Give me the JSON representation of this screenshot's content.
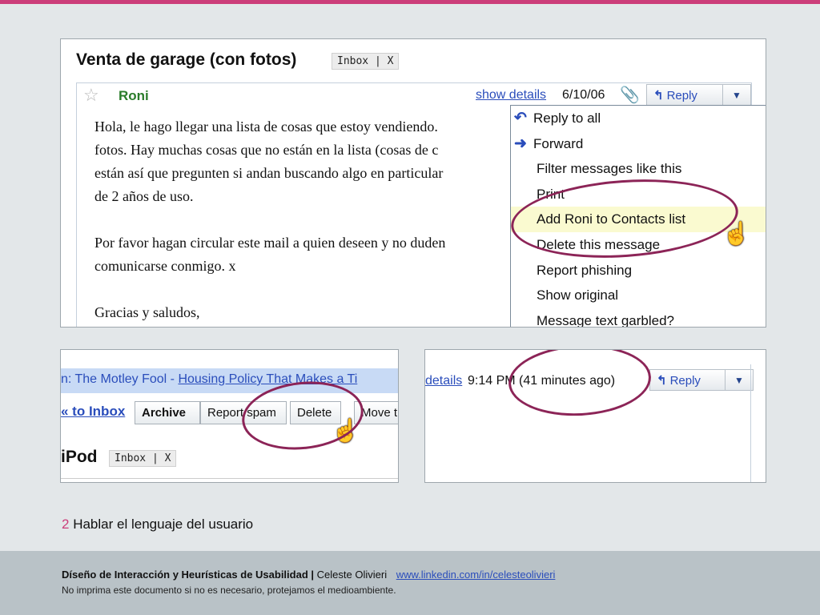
{
  "colors": {
    "accent": "#cc3e7a",
    "annotation_circle": "#8c2457",
    "link": "#2a4dbb",
    "sender": "#2a7c2a"
  },
  "main_shot": {
    "subject": "Venta de garage (con fotos)",
    "label": "Inbox | X",
    "sender": "Roni",
    "show_details": "show details",
    "date": "6/10/06",
    "reply_button": "Reply",
    "body_lines": [
      "Hola, le hago llegar una lista de cosas que estoy vendiendo.",
      "fotos. Hay muchas cosas que no están en la lista (cosas de c",
      "están así que pregunten si andan buscando algo en particular",
      "de 2 años de uso.",
      "",
      "Por favor hagan circular este mail a quien deseen y no duden",
      "comunicarse conmigo. x",
      "",
      "Gracias y saludos,"
    ],
    "menu_items": [
      {
        "label": "Reply to all",
        "icon": "reply-all-icon"
      },
      {
        "label": "Forward",
        "icon": "forward-icon"
      },
      {
        "label": "Filter messages like this"
      },
      {
        "label": "Print"
      },
      {
        "label": "Add Roni to Contacts list",
        "highlighted": true
      },
      {
        "label": "Delete this message"
      },
      {
        "label": "Report phishing"
      },
      {
        "label": "Show original"
      },
      {
        "label": "Message text garbled?"
      }
    ]
  },
  "left_shot": {
    "list_prefix": "n: The Motley Fool - ",
    "list_link": "Housing Policy That Makes a Ti",
    "back_link": "« to Inbox",
    "buttons": {
      "archive": "Archive",
      "report_spam": "Report spam",
      "delete": "Delete",
      "move": "Move t"
    },
    "title": "iPod",
    "label": "Inbox | X"
  },
  "right_shot": {
    "details_link": "details",
    "time": "9:14 PM (41 minutes ago)",
    "reply_button": "Reply"
  },
  "caption": {
    "number": "2",
    "text": "Hablar el lenguaje del usuario"
  },
  "footer": {
    "course": "Díseño de Interacción y Heurísticas de Usabilidad",
    "separator": "|",
    "author": "Celeste Olivieri",
    "url": "www.linkedin.com/in/celesteolivieri",
    "note": "No imprima este documento si no es necesario, protejamos el medioambiente."
  }
}
